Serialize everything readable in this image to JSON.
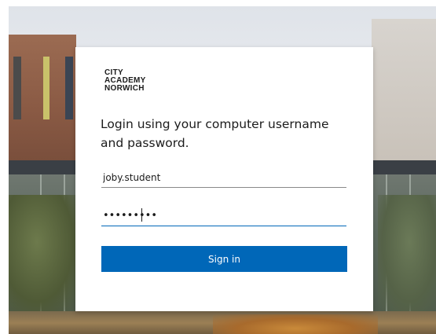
{
  "logo": {
    "line1": "CITY",
    "line2": "ACADEMY",
    "line3": "NORWICH"
  },
  "instruction": "Login using your computer username and password.",
  "username": {
    "value": "joby.student"
  },
  "password": {
    "value": "•••••••••"
  },
  "signin_label": "Sign in",
  "colors": {
    "accent": "#0067b8"
  }
}
